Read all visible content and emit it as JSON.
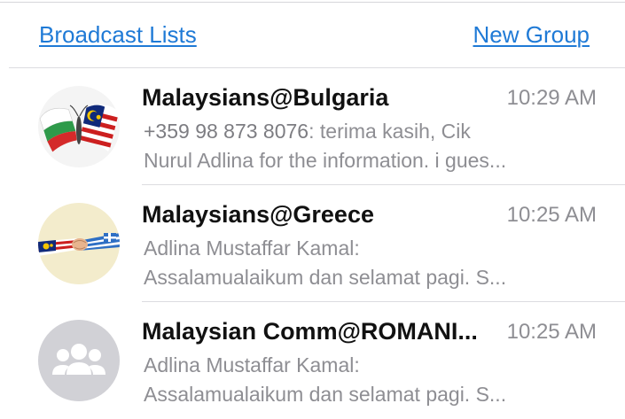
{
  "header": {
    "broadcast_label": "Broadcast Lists",
    "new_group_label": "New Group"
  },
  "chats": [
    {
      "name": "Malaysians@Bulgaria",
      "time": "10:29 AM",
      "sender": "+359 98 873 8076",
      "preview_line1_rest": ": terima kasih, Cik",
      "preview_line2": "Nurul Adlina for the information. i gues...",
      "avatar_icon": "butterfly-flags-avatar-icon"
    },
    {
      "name": "Malaysians@Greece",
      "time": "10:25 AM",
      "preview_line1": "Adlina Mustaffar Kamal:",
      "preview_line2": "Assalamualaikum dan selamat pagi.  S...",
      "avatar_icon": "handshake-flags-avatar-icon"
    },
    {
      "name": "Malaysian Comm@ROMANI...",
      "time": "10:25 AM",
      "preview_line1": "Adlina Mustaffar Kamal:",
      "preview_line2": "Assalamualaikum dan selamat pagi.  S...",
      "avatar_icon": "group-placeholder-icon"
    }
  ],
  "colors": {
    "link": "#1f7ad6",
    "secondary_text": "#8e8e93",
    "divider": "#dcdce0",
    "placeholder_avatar": "#d1d1d6"
  }
}
